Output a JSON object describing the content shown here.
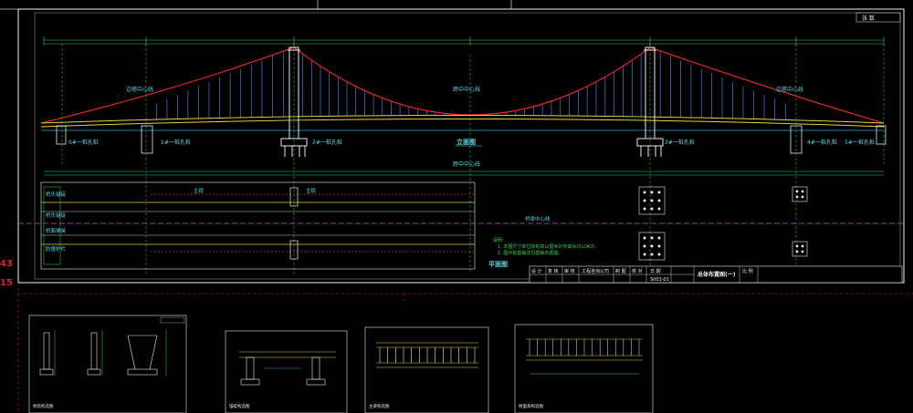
{
  "sheet": {
    "sheet_no": "张 数",
    "elevation_view": "立面图",
    "plan_view": "平面图",
    "tower_center_left": "边塔中心线",
    "span_center": "跨中中心线",
    "tower_center_right": "边塔中心线",
    "bridge_center_line": "桥梁中心线",
    "notes_title": "说明:",
    "note_1": "1. 本图尺寸单位除标高以厘米计外其余均以米计。",
    "note_2": "2. 图中桩基础详见基础布置图。",
    "pier_left": "0#一桩孔桩",
    "pier_left_b": "1#一桩孔桩",
    "pier_mid_left": "2#一桩孔桩",
    "pier_mid_right": "3#一桩孔桩",
    "pier_right_a": "4#一桩孔桩",
    "pier_right_b": "5#一桩孔桩",
    "plan_label_main": "主缆",
    "plan_label_main_r": "主缆",
    "plan_row_1": "桥头锚碇",
    "plan_row_2": "桥头锚碇",
    "plan_row_3": "桥面铺装",
    "plan_row_4": "防撞护栏",
    "drawing_no": "S003-01",
    "drawing_title": "总体布置图(一)",
    "title_block": {
      "design": "设 计",
      "check": "复 核",
      "review": "审 核",
      "company": "工程咨询公司",
      "drawing": "制 图",
      "proofread": "校 对",
      "date_label": "日 期",
      "scale_label": "比 例"
    },
    "edge_numbers": [
      "43",
      "15"
    ]
  },
  "thumbnails": [
    {
      "title": "桥塔构造图"
    },
    {
      "title": "锚碇构造图"
    },
    {
      "title": "主梁构造图"
    },
    {
      "title": "桥面系构造图"
    }
  ],
  "colors": {
    "background": "#000000",
    "frame": "#c8c8c8",
    "cable": "#d22828",
    "hanger": "#4a7bd8",
    "deck": "#e6d23a",
    "dimension": "#3cd24a",
    "center_line": "#d04ad8",
    "text_cyan": "#5ad8e6",
    "tower": "#e8e8e8",
    "ground": "#2aa8d8",
    "red_mark": "#e02020"
  }
}
